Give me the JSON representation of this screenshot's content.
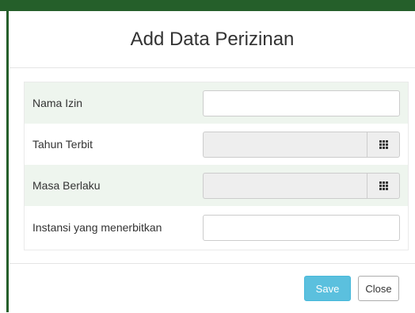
{
  "modal": {
    "title": "Add Data Perizinan",
    "fields": [
      {
        "label": "Nama Izin",
        "type": "text",
        "value": ""
      },
      {
        "label": "Tahun Terbit",
        "type": "picker",
        "value": "",
        "icon": "calendar-grid-icon"
      },
      {
        "label": "Masa Berlaku",
        "type": "picker",
        "value": "",
        "icon": "calendar-grid-icon"
      },
      {
        "label": "Instansi yang menerbitkan",
        "type": "text",
        "value": ""
      }
    ],
    "buttons": {
      "save_label": "Save",
      "close_label": "Close"
    }
  },
  "colors": {
    "topbar": "#255f2a",
    "row_alt": "#eef5ee",
    "save_button": "#5bc0de"
  }
}
